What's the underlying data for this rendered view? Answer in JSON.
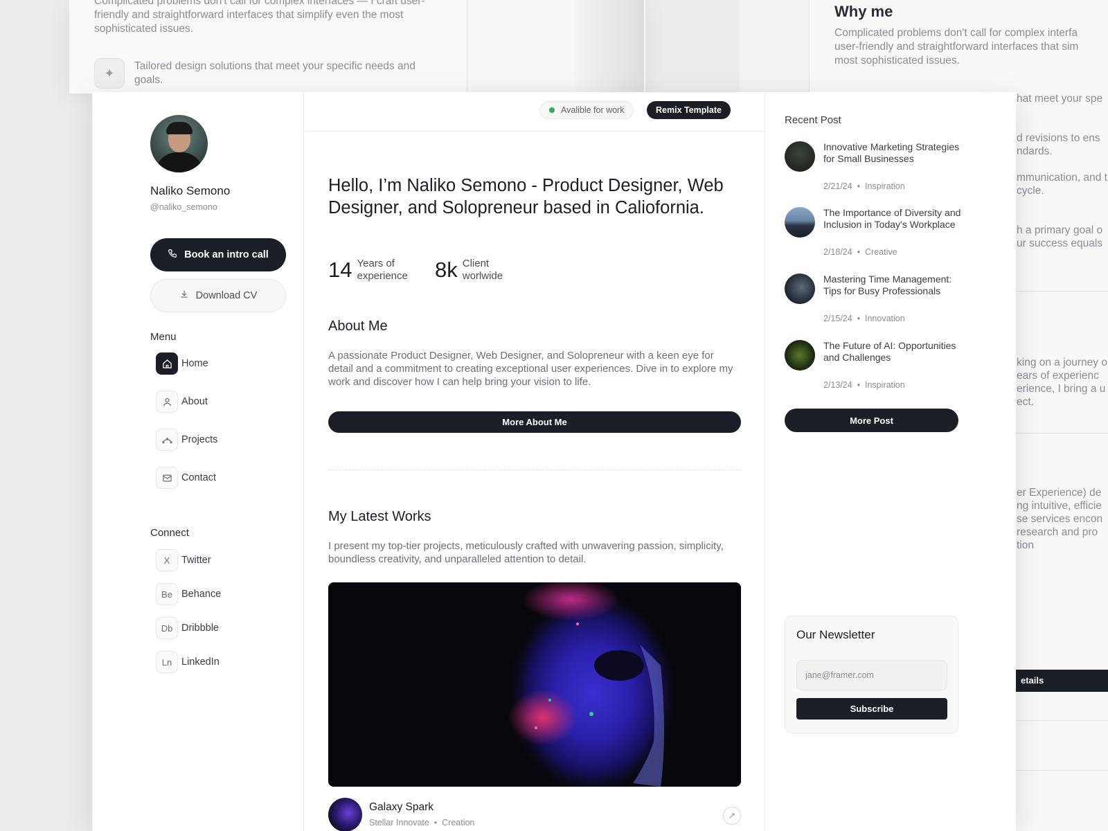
{
  "background": {
    "left_card": {
      "intro_text": "Complicated problems don't call for complex interfaces — I craft user-friendly and straightforward interfaces that simplify even the most sophisticated issues.",
      "sparkle_icon": "sparkle-icon",
      "tailored_text": "Tailored design solutions that meet your specific needs and goals."
    },
    "right_card": {
      "heading": "Why me",
      "para_lines": [
        "Complicated problems don't call for complex interfa",
        "user-friendly and straightforward interfaces that sim",
        "most sophisticated issues."
      ],
      "fragments": [
        "hat meet your spe",
        "d revisions to ens",
        "ndards.",
        "mmunication, and t",
        "cycle.",
        "h a primary goal o",
        "ur success equals",
        "king on a journey o",
        "ears of experienc",
        "erience, I bring a u",
        "ect.",
        "er Experience) de",
        "ng intuitive, efficie",
        "se services encon",
        "research and pro",
        "tion"
      ],
      "bar_label": "etails"
    }
  },
  "profile": {
    "name": "Naliko Semono",
    "handle": "@naliko_semono",
    "book_button": "Book an intro call",
    "cv_button": "Download CV"
  },
  "menu": {
    "label": "Menu",
    "items": [
      {
        "label": "Home",
        "icon": "home-icon",
        "active": true
      },
      {
        "label": "About",
        "icon": "user-icon",
        "active": false
      },
      {
        "label": "Projects",
        "icon": "projects-icon",
        "active": false
      },
      {
        "label": "Contact",
        "icon": "mail-icon",
        "active": false
      }
    ]
  },
  "connect": {
    "label": "Connect",
    "items": [
      {
        "label": "Twitter",
        "abbr": "X"
      },
      {
        "label": "Behance",
        "abbr": "Be"
      },
      {
        "label": "Dribbble",
        "abbr": "Db"
      },
      {
        "label": "LinkedIn",
        "abbr": "Ln"
      }
    ]
  },
  "topbar": {
    "status": "Avalible for work",
    "remix": "Remix Template"
  },
  "hero": {
    "headline": "Hello, I’m Naliko Semono - Product Designer, Web Designer, and Solopreneur based in Caliofornia.",
    "stats": [
      {
        "value": "14",
        "label_line1": "Years of",
        "label_line2": "experience"
      },
      {
        "value": "8k",
        "label_line1": "Client",
        "label_line2": "worlwide"
      }
    ]
  },
  "about": {
    "title": "About Me",
    "text": "A passionate Product Designer, Web Designer, and Solopreneur with a keen eye for detail and a commitment to creating exceptional user experiences. Dive in to explore my work and discover how I can help bring your vision to life.",
    "button": "More About Me"
  },
  "works": {
    "title": "My Latest Works",
    "text": "I present my top-tier projects, meticulously crafted with unwavering passion, simplicity, boundless creativity, and unparalleled attention to detail.",
    "item": {
      "title": "Galaxy Spark",
      "client": "Stellar Innovate",
      "category": "Creation"
    }
  },
  "recent": {
    "title": "Recent Post",
    "posts": [
      {
        "title": "Innovative Marketing Strategies for Small Businesses",
        "date": "2/21/24",
        "tag": "Inspiration"
      },
      {
        "title": "The Importance of Diversity and Inclusion in Today's Workplace",
        "date": "2/18/24",
        "tag": "Creative"
      },
      {
        "title": "Mastering Time Management: Tips for Busy Professionals",
        "date": "2/15/24",
        "tag": "Innovation"
      },
      {
        "title": "The Future of AI: Opportunities and Challenges",
        "date": "2/13/24",
        "tag": "Inspiration"
      }
    ],
    "more_button": "More Post"
  },
  "newsletter": {
    "title": "Our Newsletter",
    "placeholder": "jane@framer.com",
    "button": "Subscribe"
  },
  "colors": {
    "ink": "#1b1e27",
    "status_green": "#22b553"
  }
}
